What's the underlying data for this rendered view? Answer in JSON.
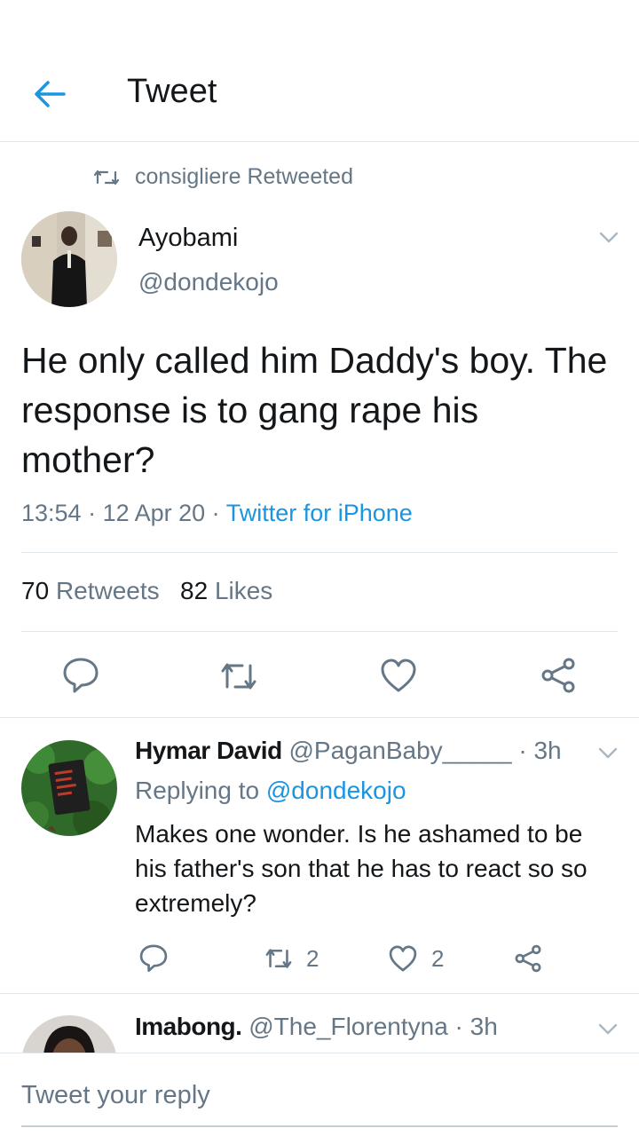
{
  "header": {
    "title": "Tweet"
  },
  "retweet_context": {
    "text": "consigliere Retweeted"
  },
  "tweet": {
    "author_name": "Ayobami",
    "author_handle": "@dondekojo",
    "text": "He only called him Daddy's boy. The response is to gang rape his mother?",
    "time": "13:54",
    "date": "12 Apr 20",
    "source": "Twitter for iPhone",
    "retweet_count": "70",
    "retweet_label": "Retweets",
    "like_count": "82",
    "like_label": "Likes"
  },
  "replies": [
    {
      "name": "Hymar David",
      "handle": "@PaganBaby_____",
      "time": "3h",
      "replying_prefix": "Replying to",
      "replying_to": "@dondekojo",
      "text": "Makes one wonder. Is he ashamed to be his father's son that he has to react so so extremely?",
      "retweets": "2",
      "likes": "2"
    },
    {
      "name": "Imabong.",
      "handle": "@The_Florentyna",
      "time": "3h"
    }
  ],
  "reply_box": {
    "placeholder": "Tweet your reply"
  },
  "colors": {
    "accent": "#1b95e0",
    "secondary_text": "#657786",
    "divider": "#e1e8ed"
  },
  "icons": [
    "back-arrow-icon",
    "retweet-icon",
    "chevron-down-icon",
    "reply-icon",
    "like-icon",
    "share-icon"
  ]
}
